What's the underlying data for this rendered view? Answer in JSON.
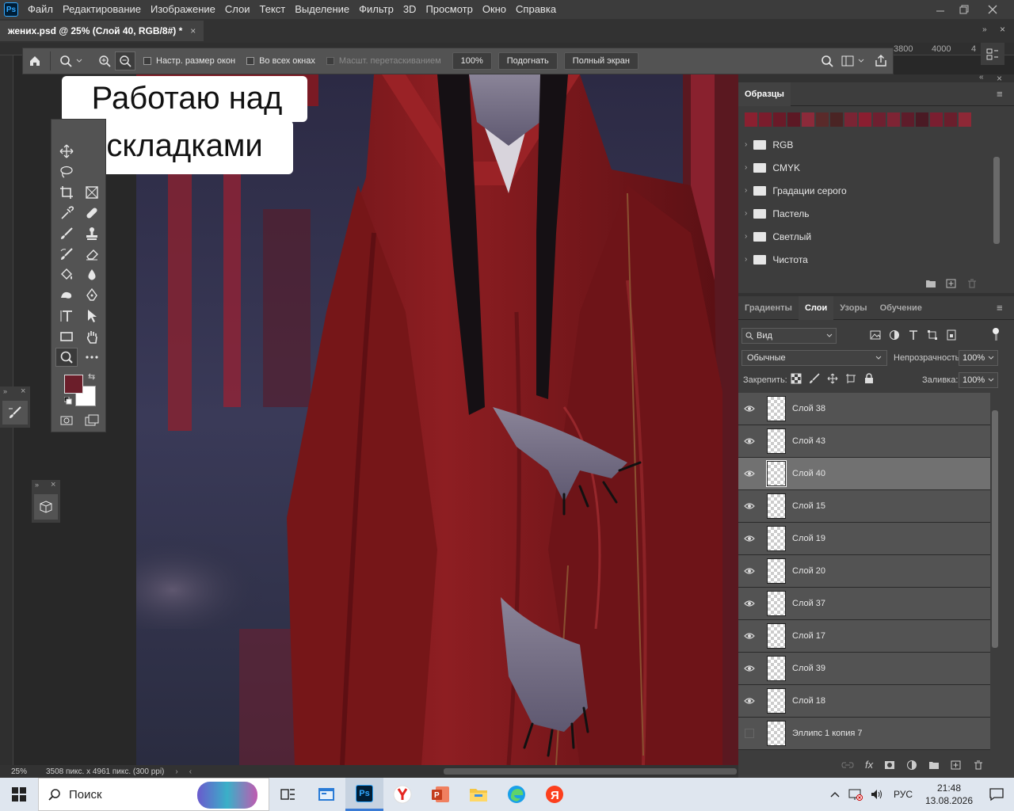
{
  "menubar": {
    "items": [
      "Файл",
      "Редактирование",
      "Изображение",
      "Слои",
      "Текст",
      "Выделение",
      "Фильтр",
      "3D",
      "Просмотр",
      "Окно",
      "Справка"
    ]
  },
  "document": {
    "tab_title": "жених.psd @ 25% (Слой 40, RGB/8#) *"
  },
  "ruler": {
    "labels": [
      "3800",
      "4000",
      "4"
    ]
  },
  "options_bar": {
    "resize_windows": "Настр. размер окон",
    "all_windows": "Во всех окнах",
    "scrubby_zoom": "Масшт. перетаскиванием",
    "zoom_value": "100%",
    "fit_button": "Подогнать",
    "fullscreen_button": "Полный экран"
  },
  "caption": {
    "line1": "Работаю над",
    "line2": "складками"
  },
  "colors": {
    "foreground": "#6b1e2a",
    "background": "#ffffff"
  },
  "swatches_panel": {
    "title": "Образцы",
    "swatch_colors": [
      "#8a2030",
      "#7a1c2c",
      "#6a1a28",
      "#5c1824",
      "#8c2a3a",
      "#5a2a2a",
      "#4a2424",
      "#7a2434",
      "#8a1e30",
      "#6e2030",
      "#7e2434",
      "#5e1c2a",
      "#4a1a24",
      "#7a1e30",
      "#6a1e2c",
      "#8e2836"
    ],
    "groups": [
      "RGB",
      "CMYK",
      "Градации серого",
      "Пастель",
      "Светлый",
      "Чистота"
    ]
  },
  "layers_panel": {
    "tabs": [
      "Градиенты",
      "Слои",
      "Узоры",
      "Обучение"
    ],
    "active_tab": "Слои",
    "filter_kind": "Вид",
    "blend_mode": "Обычные",
    "opacity_label": "Непрозрачность:",
    "opacity_value": "100%",
    "lock_label": "Закрепить:",
    "fill_label": "Заливка:",
    "fill_value": "100%",
    "layers": [
      {
        "name": "Слой 38",
        "visible": true,
        "selected": false
      },
      {
        "name": "Слой 43",
        "visible": true,
        "selected": false
      },
      {
        "name": "Слой 40",
        "visible": true,
        "selected": true
      },
      {
        "name": "Слой 15",
        "visible": true,
        "selected": false
      },
      {
        "name": "Слой 19",
        "visible": true,
        "selected": false
      },
      {
        "name": "Слой 20",
        "visible": true,
        "selected": false
      },
      {
        "name": "Слой 37",
        "visible": true,
        "selected": false
      },
      {
        "name": "Слой 17",
        "visible": true,
        "selected": false
      },
      {
        "name": "Слой 39",
        "visible": true,
        "selected": false
      },
      {
        "name": "Слой 18",
        "visible": true,
        "selected": false
      },
      {
        "name": "Эллипс 1 копия 7",
        "visible": false,
        "selected": false
      }
    ]
  },
  "status_bar": {
    "zoom": "25%",
    "doc_info": "3508 пикс. x 4961 пикс. (300 ppi)"
  },
  "taskbar": {
    "search_placeholder": "Поиск",
    "language": "РУС",
    "time": "21:48",
    "date": "13.08.2026"
  }
}
